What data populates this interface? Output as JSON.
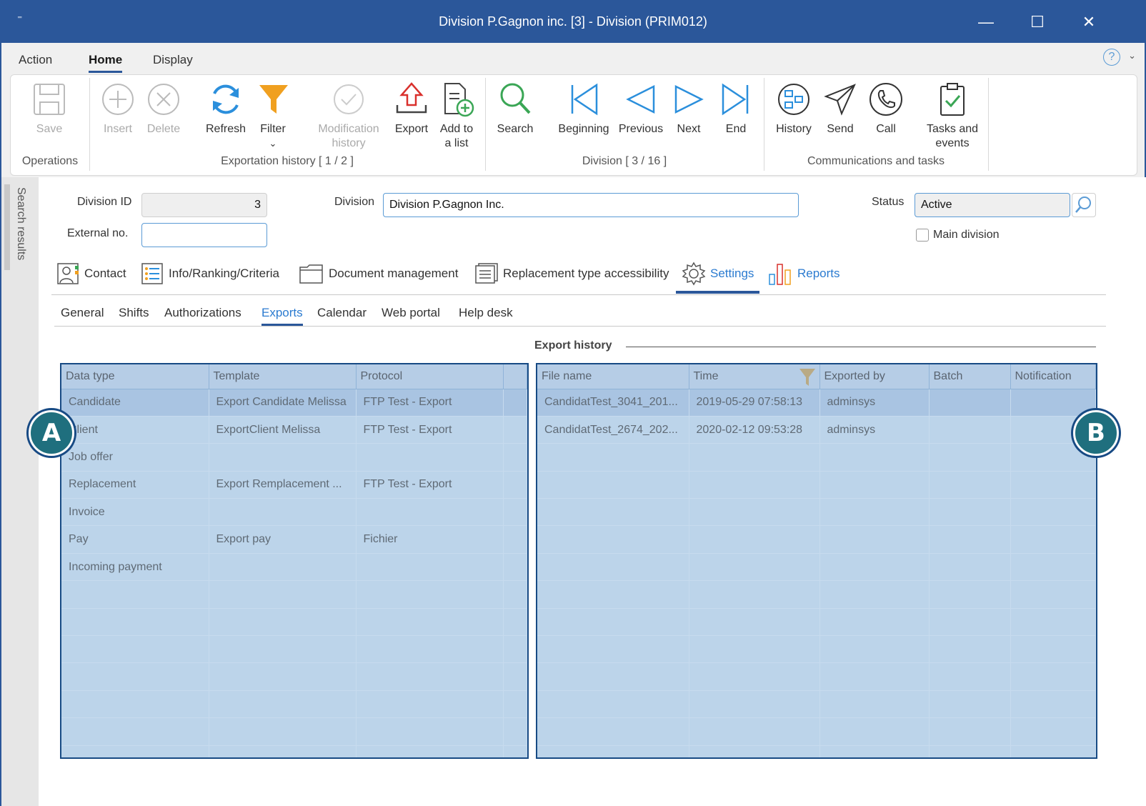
{
  "window": {
    "title": "Division P.Gagnon inc. [3] - Division (PRIM012)",
    "quick_access": "⁼",
    "minimize": "—",
    "maximize": "☐",
    "close": "✕"
  },
  "menu": {
    "tabs": [
      "Action",
      "Home",
      "Display"
    ],
    "active": "Home",
    "help": "?",
    "help_chevron": "⌄"
  },
  "ribbon": {
    "buttons": {
      "save": "Save",
      "insert": "Insert",
      "delete": "Delete",
      "refresh": "Refresh",
      "filter": "Filter",
      "filter_arrow": "⌄",
      "modification_history_1": "Modification",
      "modification_history_2": "history",
      "export": "Export",
      "add_to_list_1": "Add to",
      "add_to_list_2": "a list",
      "search": "Search",
      "beginning": "Beginning",
      "previous": "Previous",
      "next": "Next",
      "end": "End",
      "history": "History",
      "send": "Send",
      "call": "Call",
      "tasks_1": "Tasks and",
      "tasks_2": "events"
    },
    "groups": {
      "operations": "Operations",
      "exportation": "Exportation history [ 1 / 2 ]",
      "division": "Division [ 3 / 16 ]",
      "communications": "Communications and tasks"
    },
    "colors": {
      "accent": "#2b579a",
      "blue_icon": "#2b8fdc",
      "green_icon": "#3aa655",
      "orange_icon": "#f0a020",
      "red_icon": "#d9302c"
    }
  },
  "sidebar": {
    "search_results": "Search results"
  },
  "form": {
    "division_id_label": "Division ID",
    "division_id_value": "3",
    "external_no_label": "External no.",
    "external_no_value": "",
    "division_label": "Division",
    "division_value": "Division P.Gagnon Inc.",
    "status_label": "Status",
    "status_value": "Active",
    "main_division_label": "Main division"
  },
  "page_tabs": {
    "contact": "Contact",
    "info": "Info/Ranking/Criteria",
    "documents": "Document management",
    "replacement": "Replacement type accessibility",
    "settings": "Settings",
    "reports": "Reports"
  },
  "sub_tabs": {
    "general": "General",
    "shifts": "Shifts",
    "authorizations": "Authorizations",
    "exports": "Exports",
    "calendar": "Calendar",
    "web_portal": "Web portal",
    "help_desk": "Help desk"
  },
  "export_history_title": "Export history",
  "grid_a": {
    "headers": [
      "Data type",
      "Template",
      "Protocol"
    ],
    "rows": [
      [
        "Candidate",
        "Export Candidate Melissa",
        "FTP Test - Export"
      ],
      [
        "Client",
        "ExportClient Melissa",
        "FTP Test - Export"
      ],
      [
        "Job offer",
        "",
        ""
      ],
      [
        "Replacement",
        "Export Remplacement ...",
        "FTP Test - Export"
      ],
      [
        "Invoice",
        "",
        ""
      ],
      [
        "Pay",
        "Export pay",
        "Fichier"
      ],
      [
        "Incoming payment",
        "",
        ""
      ]
    ]
  },
  "grid_b": {
    "headers": [
      "File name",
      "Time",
      "Exported by",
      "Batch",
      "Notification"
    ],
    "rows": [
      [
        "CandidatTest_3041_201...",
        "2019-05-29 07:58:13",
        "adminsys",
        "",
        ""
      ],
      [
        "CandidatTest_2674_202...",
        "2020-02-12 09:53:28",
        "adminsys",
        "",
        ""
      ]
    ]
  },
  "badges": {
    "a": "A",
    "b": "B"
  }
}
